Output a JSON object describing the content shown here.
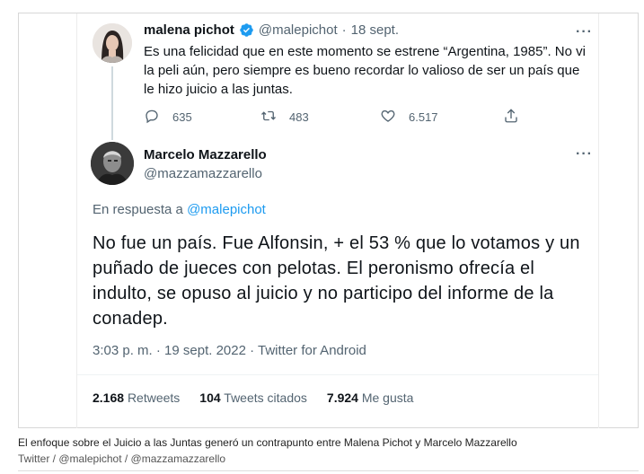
{
  "tweet1": {
    "author_name": "malena pichot",
    "handle": "@malepichot",
    "separator": "·",
    "date": "18 sept.",
    "more": "···",
    "text": "Es una felicidad que en este momento se estrene “Argentina, 1985”. No vi la peli aún, pero siempre es bueno recordar lo valioso de ser un país que le hizo juicio a las juntas.",
    "replies": "635",
    "retweets": "483",
    "likes": "6.517"
  },
  "tweet2": {
    "author_name": "Marcelo Mazzarello",
    "handle": "@mazzamazzarello",
    "more": "···",
    "reply_prefix": "En respuesta a",
    "reply_handle": "@malepichot",
    "text": "No fue un país. Fue Alfonsin, + el 53 % que lo votamos y un puñado de jueces con pelotas. El peronismo ofrecía el indulto, se opuso al juicio  y no participo del informe de la conadep.",
    "timestamp": "3:03 p. m. · 19 sept. 2022 · Twitter for Android",
    "retweets_count": "2.168",
    "retweets_label": "Retweets",
    "quotes_count": "104",
    "quotes_label": "Tweets citados",
    "likes_count": "7.924",
    "likes_label": "Me gusta"
  },
  "caption": "El enfoque sobre el Juicio a las Juntas generó un contrapunto entre Malena Pichot y Marcelo Mazzarello",
  "credit": "Twitter / @malepichot / @mazzamazzarello",
  "colors": {
    "accent": "#1d9bf0",
    "muted": "#536471"
  },
  "icons": [
    "verified-badge-icon",
    "reply-icon",
    "retweet-icon",
    "like-icon",
    "share-icon",
    "more-icon"
  ]
}
